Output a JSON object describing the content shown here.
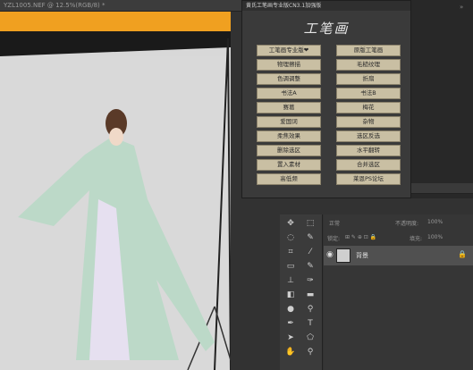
{
  "document": {
    "tab_title": "YZL1005.NEF @ 12.5%(RGB/8) *"
  },
  "plugin": {
    "title": "黄氏工笔画专业版CN3.1加强版",
    "logo": "工笔画",
    "buttons_left": [
      "工笔画专业版❤",
      "物理擦描",
      "色调调整",
      "书法A",
      "赛葛",
      "爱国词",
      "柔焦效果",
      "删除选区",
      "置入素材",
      "高低频"
    ],
    "buttons_right": [
      "原版工笔画",
      "毛糙纹理",
      "折扇",
      "书法B",
      "梅花",
      "杂物",
      "选区反选",
      "水平翻转",
      "合并选区",
      "莱恩PS论坛"
    ]
  },
  "layers": {
    "blend_mode": "正常",
    "opacity_label": "不透明度:",
    "opacity_value": "100%",
    "lock_label": "锁定:",
    "fill_label": "填充:",
    "fill_value": "100%",
    "layer_name": "背景"
  },
  "toolbar": {
    "tools": [
      "move-icon",
      "marquee-icon",
      "lasso-icon",
      "quick-select-icon",
      "crop-icon",
      "eyedropper-icon",
      "frame-icon",
      "brush-icon",
      "stamp-icon",
      "history-brush-icon",
      "eraser-icon",
      "gradient-icon",
      "blur-icon",
      "dodge-icon",
      "pen-icon",
      "type-icon",
      "path-select-icon",
      "shape-icon",
      "hand-icon",
      "zoom-icon"
    ],
    "glyphs": [
      "✥",
      "⬚",
      "◌",
      "✎",
      "⌗",
      "⁄",
      "▭",
      "✎",
      "⊥",
      "✑",
      "◧",
      "▬",
      "●",
      "⚲",
      "✒",
      "T",
      "➤",
      "⬠",
      "✋",
      "⚲"
    ]
  }
}
